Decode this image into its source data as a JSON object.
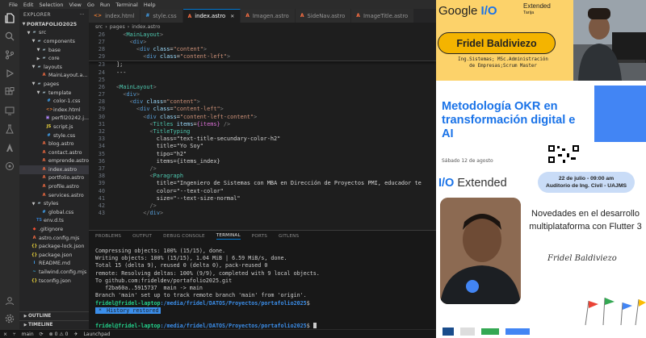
{
  "menu": [
    "File",
    "Edit",
    "Selection",
    "View",
    "Go",
    "Run",
    "Terminal",
    "Help"
  ],
  "explorer": {
    "title": "EXPLORER",
    "tree": [
      {
        "label": "PORTAFOLIO2025",
        "depth": 0,
        "kind": "root"
      },
      {
        "label": "src",
        "depth": 1,
        "kind": "folder-open"
      },
      {
        "label": "components",
        "depth": 2,
        "kind": "folder-open"
      },
      {
        "label": "base",
        "depth": 3,
        "kind": "folder-open"
      },
      {
        "label": "core",
        "depth": 3,
        "kind": "folder"
      },
      {
        "label": "layouts",
        "depth": 2,
        "kind": "folder-open"
      },
      {
        "label": "MainLayout.a...",
        "depth": 3,
        "kind": "astro"
      },
      {
        "label": "pages",
        "depth": 2,
        "kind": "folder-open"
      },
      {
        "label": "template",
        "depth": 3,
        "kind": "folder-open"
      },
      {
        "label": "color-1.css",
        "depth": 4,
        "kind": "css"
      },
      {
        "label": "index.html",
        "depth": 4,
        "kind": "html"
      },
      {
        "label": "perfil20242.j...",
        "depth": 4,
        "kind": "img"
      },
      {
        "label": "script.js",
        "depth": 4,
        "kind": "js"
      },
      {
        "label": "style.css",
        "depth": 4,
        "kind": "css"
      },
      {
        "label": "blog.astro",
        "depth": 3,
        "kind": "astro"
      },
      {
        "label": "contact.astro",
        "depth": 3,
        "kind": "astro"
      },
      {
        "label": "emprende.astro",
        "depth": 3,
        "kind": "astro"
      },
      {
        "label": "index.astro",
        "depth": 3,
        "kind": "astro",
        "selected": true
      },
      {
        "label": "portfolio.astro",
        "depth": 3,
        "kind": "astro"
      },
      {
        "label": "profile.astro",
        "depth": 3,
        "kind": "astro"
      },
      {
        "label": "services.astro",
        "depth": 3,
        "kind": "astro"
      },
      {
        "label": "styles",
        "depth": 2,
        "kind": "folder-open"
      },
      {
        "label": "global.css",
        "depth": 3,
        "kind": "css"
      },
      {
        "label": "env.d.ts",
        "depth": 2,
        "kind": "ts"
      },
      {
        "label": ".gitignore",
        "depth": 1,
        "kind": "git"
      },
      {
        "label": "astro.config.mjs",
        "depth": 1,
        "kind": "astro"
      },
      {
        "label": "package-lock.json",
        "depth": 1,
        "kind": "json"
      },
      {
        "label": "package.json",
        "depth": 1,
        "kind": "json"
      },
      {
        "label": "README.md",
        "depth": 1,
        "kind": "md"
      },
      {
        "label": "tailwind.config.mjs",
        "depth": 1,
        "kind": "tw"
      },
      {
        "label": "tsconfig.json",
        "depth": 1,
        "kind": "json"
      }
    ],
    "outline": "OUTLINE",
    "timeline": "TIMELINE"
  },
  "tabs": [
    {
      "label": "index.html",
      "icon": "<>",
      "color": "#e37933"
    },
    {
      "label": "style.css",
      "icon": "#",
      "color": "#42a5f5"
    },
    {
      "label": "index.astro",
      "icon": "A",
      "color": "#ff7043",
      "active": true
    },
    {
      "label": "Imagen.astro",
      "icon": "A",
      "color": "#ff7043"
    },
    {
      "label": "SideNav.astro",
      "icon": "A",
      "color": "#ff7043"
    },
    {
      "label": "ImageTitle.astro",
      "icon": "A",
      "color": "#ff7043"
    }
  ],
  "breadcrumb": [
    "src",
    "pages",
    "index.astro"
  ],
  "code_sticky": [
    {
      "n": "26",
      "t": "  <MainLayout>"
    },
    {
      "n": "27",
      "t": "    <div>"
    },
    {
      "n": "28",
      "t": "      <div class=\"content\">"
    },
    {
      "n": "29",
      "t": "        <div class=\"content-left\">"
    }
  ],
  "code": [
    {
      "n": "23",
      "t": "];"
    },
    {
      "n": "24",
      "t": "---"
    },
    {
      "n": "25",
      "t": ""
    },
    {
      "n": "26",
      "t": "<MainLayout>"
    },
    {
      "n": "27",
      "t": "  <div>"
    },
    {
      "n": "28",
      "t": "    <div class=\"content\">"
    },
    {
      "n": "29",
      "t": "      <div class=\"content-left\">"
    },
    {
      "n": "30",
      "t": "        <div class=\"content-left-content\">"
    },
    {
      "n": "31",
      "t": "          <Titles items={items} />"
    },
    {
      "n": "32",
      "t": "          <TitleTyping"
    },
    {
      "n": "33",
      "t": "            class=\"text-title-secundary-color-h2\""
    },
    {
      "n": "34",
      "t": "            title=\"Yo Soy\""
    },
    {
      "n": "35",
      "t": "            tipo=\"h2\""
    },
    {
      "n": "36",
      "t": "            items={items_index}"
    },
    {
      "n": "37",
      "t": "          />"
    },
    {
      "n": "38",
      "t": "          <Paragraph"
    },
    {
      "n": "39",
      "t": "            title=\"Ingeniero de Sistemas con MBA en Dirección de Proyectos PMI, educador te"
    },
    {
      "n": "40",
      "t": "            color=\"--text-color\""
    },
    {
      "n": "41",
      "t": "            size=\"--text-size-normal\""
    },
    {
      "n": "42",
      "t": "          />"
    },
    {
      "n": "43",
      "t": "        </div>"
    }
  ],
  "panel_tabs": [
    "PROBLEMS",
    "OUTPUT",
    "DEBUG CONSOLE",
    "TERMINAL",
    "PORTS",
    "GITLENS"
  ],
  "terminal": {
    "lines": [
      "Compressing objects: 100% (15/15), done.",
      "Writing objects: 100% (15/15), 1.04 MiB | 6.59 MiB/s, done.",
      "Total 15 (delta 9), reused 0 (delta 0), pack-reused 0",
      "remote: Resolving deltas: 100% (9/9), completed with 9 local objects.",
      "To github.com:frideldev/portafolio2025.git",
      "   f2ba60a..5915737  main -> main",
      "Branch 'main' set up to track remote branch 'main' from 'origin'."
    ],
    "prompt_user": "fridel@fridel-laptop",
    "prompt_path": ":/media/fridel/DATOS/Proyectos/portafolio2025",
    "history": "History restored"
  },
  "status": [
    "main",
    "Launchpad"
  ],
  "right": {
    "google": "Google",
    "extended": "Extended",
    "city": "Tarija",
    "speaker": "Fridel Baldiviezo",
    "role1": "Ing.Sistemas; MSc.Administración",
    "role2": "de Empresas;Scrum Master",
    "talk_title": "Metodología OKR en transformación digital e AI",
    "talk_date": "Sábado 12 de agosto",
    "ext_brand": "Extended",
    "event_date": "22 de julio - 09:00 am",
    "event_place": "Auditorio de Ing. Civil - UAJMS",
    "news": "Novedades en el desarrollo multiplataforma con Flutter 3",
    "signature": "Fridel Baldiviezo",
    "colors": {
      "google_yellow": "#f4b400",
      "google_blue": "#1a73e8"
    }
  }
}
